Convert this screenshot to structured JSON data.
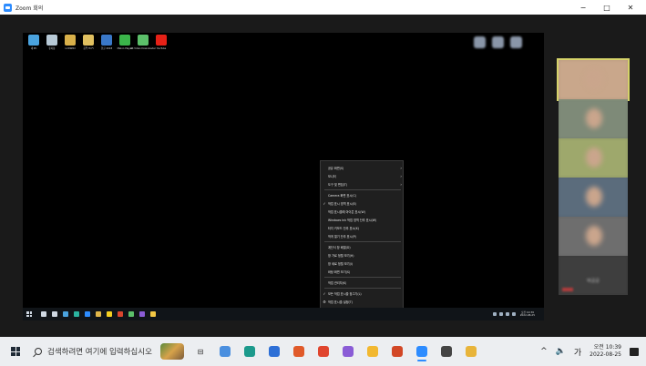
{
  "window": {
    "title": "Zoom 회의",
    "minimize": "−",
    "maximize": "□",
    "close": "✕"
  },
  "desktop_icons": [
    {
      "label": "내 PC",
      "icon": "pc-icon",
      "color": "#4aa3df"
    },
    {
      "label": "휴지통",
      "icon": "recycle-bin-icon",
      "color": "#b7c9d6"
    },
    {
      "label": "LCDWIKI",
      "icon": "folder-icon",
      "color": "#d8b04a"
    },
    {
      "label": "음악 Hi Fi",
      "icon": "folder-icon",
      "color": "#e0c060"
    },
    {
      "label": "한글 2018",
      "icon": "hangul-icon",
      "color": "#3a78c8"
    },
    {
      "label": "Melon Player",
      "icon": "melon-icon",
      "color": "#3bb54a"
    },
    {
      "label": "4K Video Downloader",
      "icon": "4k-downloader-icon",
      "color": "#5cc06a"
    },
    {
      "label": "YouTube",
      "icon": "youtube-icon",
      "color": "#e62117"
    }
  ],
  "context_menu": {
    "items": [
      {
        "label": "공유 화면(S)",
        "checked": false,
        "submenu": true
      },
      {
        "label": "모니터",
        "checked": false,
        "submenu": true
      },
      {
        "label": "도구 및 편집(T)",
        "checked": false,
        "submenu": true
      },
      {
        "label": "Camera 화면 표시(C)",
        "checked": false,
        "submenu": false
      },
      {
        "label": "작업 표시 영역 표시(E)",
        "checked": true,
        "submenu": false
      },
      {
        "label": "작업 표시줄에 아이콘 표시(W)",
        "checked": false,
        "submenu": false
      },
      {
        "label": "Windows Ink 작업 영역 단추 표시(W)",
        "checked": false,
        "submenu": false
      },
      {
        "label": "터치 키보드 단추 표시(K)",
        "checked": false,
        "submenu": false
      },
      {
        "label": "작게 열기 단추 표시(P)",
        "checked": false,
        "submenu": false
      },
      {
        "label": "계단식 창 배열(D)",
        "checked": false,
        "submenu": false
      },
      {
        "label": "창 가로 정렬 보기(H)",
        "checked": false,
        "submenu": false
      },
      {
        "label": "창 세로 정렬 보기(I)",
        "checked": false,
        "submenu": false
      },
      {
        "label": "바탕 화면 보기(S)",
        "checked": false,
        "submenu": false
      },
      {
        "label": "작업 관리자(K)",
        "checked": false,
        "submenu": false
      },
      {
        "label": "모든 작업 표시줄 잠그기(L)",
        "checked": true,
        "submenu": false
      },
      {
        "label": "작업 표시줄 설정(T)",
        "checked": false,
        "submenu": false,
        "gear": true
      }
    ]
  },
  "inner_taskbar": {
    "icons": [
      {
        "name": "search-icon",
        "color": "#cfd8e3"
      },
      {
        "name": "task-view-icon",
        "color": "#cfd8e3"
      },
      {
        "name": "chrome-icon",
        "color": "#4aa3df"
      },
      {
        "name": "edge-icon",
        "color": "#2bb3a0"
      },
      {
        "name": "zoom-icon",
        "color": "#2d8cff"
      },
      {
        "name": "explorer-icon",
        "color": "#e0b64a"
      },
      {
        "name": "kakaotalk-icon",
        "color": "#f5d021"
      },
      {
        "name": "office-icon",
        "color": "#d9452e"
      },
      {
        "name": "app-icon",
        "color": "#5cc06a"
      },
      {
        "name": "app-icon",
        "color": "#8a5cd6"
      },
      {
        "name": "notes-icon",
        "color": "#f2c744"
      }
    ],
    "clock": {
      "time": "오전 10:39",
      "date": "2022-08-25"
    }
  },
  "gallery": [
    {
      "name": "participant-1",
      "active": true,
      "bg": "#c9a78b"
    },
    {
      "name": "participant-2",
      "active": false,
      "bg": "#7e8a78"
    },
    {
      "name": "participant-3",
      "active": false,
      "bg": "#9ea86c"
    },
    {
      "name": "participant-4",
      "active": false,
      "bg": "#5b6c7c"
    },
    {
      "name": "participant-5",
      "active": false,
      "bg": "#6e6e6e"
    },
    {
      "name": "participant-6",
      "active": false,
      "bg": "#3e3e3e",
      "label": "박공공"
    }
  ],
  "taskbar": {
    "search_placeholder": "검색하려면 여기에 입력하십시오",
    "apps": [
      {
        "name": "task-view-icon",
        "color": "#2b2b2b",
        "glyph": "⊟"
      },
      {
        "name": "chrome-icon",
        "color": "#4a8fdf",
        "glyph": ""
      },
      {
        "name": "edge-icon",
        "color": "#1c9a8c",
        "glyph": ""
      },
      {
        "name": "app-icon",
        "color": "#2d6fd6",
        "glyph": ""
      },
      {
        "name": "chrome-icon",
        "color": "#e05a2a",
        "glyph": ""
      },
      {
        "name": "office-icon",
        "color": "#e0452e",
        "glyph": ""
      },
      {
        "name": "settings-icon",
        "color": "#8a5cd6",
        "glyph": ""
      },
      {
        "name": "kakaotalk-icon",
        "color": "#f2b830",
        "glyph": ""
      },
      {
        "name": "powerpoint-icon",
        "color": "#d24726",
        "glyph": ""
      },
      {
        "name": "zoom-icon",
        "color": "#2d8cff",
        "glyph": "",
        "selected": true
      },
      {
        "name": "obs-icon",
        "color": "#444444",
        "glyph": ""
      },
      {
        "name": "file-explorer-icon",
        "color": "#e8b43a",
        "glyph": ""
      }
    ],
    "tray": {
      "chevron": "^",
      "ime": "가",
      "clock_time": "오전 10:39",
      "clock_date": "2022-08-25"
    }
  }
}
